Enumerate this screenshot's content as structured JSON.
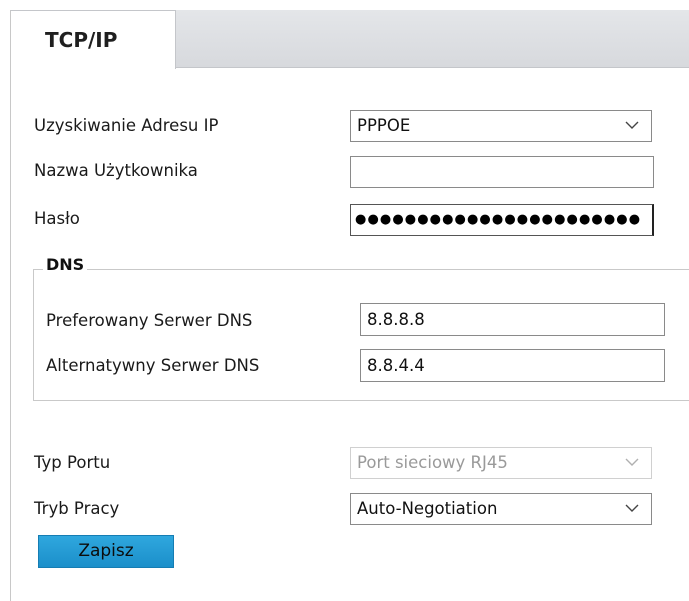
{
  "tabs": [
    {
      "label": "TCP/IP",
      "active": true
    }
  ],
  "form": {
    "ip_mode": {
      "label": "Uzyskiwanie Adresu IP",
      "value": "PPPOE"
    },
    "username": {
      "label": "Nazwa Użytkownika",
      "value": ""
    },
    "password": {
      "label": "Hasło",
      "masked_value": "●●●●●●●●●●●●●●●●●●●●●●●"
    },
    "dns": {
      "legend": "DNS",
      "preferred": {
        "label": "Preferowany Serwer DNS",
        "value": "8.8.8.8"
      },
      "alternate": {
        "label": "Alternatywny Serwer DNS",
        "value": "8.8.4.4"
      }
    },
    "port_type": {
      "label": "Typ Portu",
      "value": "Port sieciowy RJ45",
      "disabled": true
    },
    "work_mode": {
      "label": "Tryb Pracy",
      "value": "Auto-Negotiation"
    }
  },
  "actions": {
    "save_label": "Zapisz"
  },
  "colors": {
    "save_button": "#1b8fca",
    "tab_bar": "#d7d9dd"
  }
}
